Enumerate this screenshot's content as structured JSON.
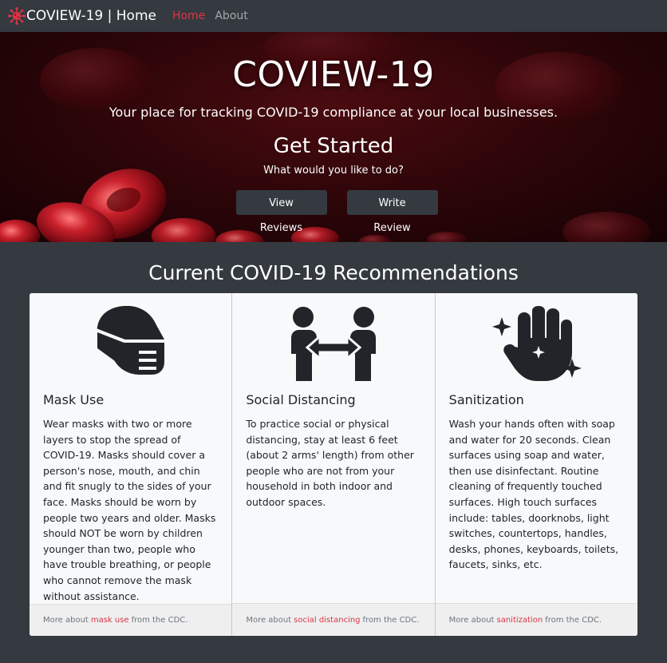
{
  "nav": {
    "brand": "COVIEW-19 | Home",
    "links": [
      "Home",
      "About"
    ]
  },
  "hero": {
    "title": "COVIEW-19",
    "lead": "Your place for tracking COVID-19 compliance at your local businesses.",
    "cta_title": "Get Started",
    "cta_prompt": "What would you like to do?",
    "buttons": [
      "View Reviews",
      "Write Review"
    ]
  },
  "recommendations": {
    "title": "Current COVID-19 Recommendations",
    "cards": [
      {
        "icon": "head-side-mask-icon",
        "title": "Mask Use",
        "text": "Wear masks with two or more layers to stop the spread of COVID-19. Masks should cover a person's nose, mouth, and chin and fit snugly to the sides of your face. Masks should be worn by people two years and older. Masks should NOT be worn by children younger than two, people who have trouble breathing, or people who cannot remove the mask without assistance.",
        "footer_prefix": "More about",
        "footer_link": "mask use",
        "footer_suffix": "from the CDC."
      },
      {
        "icon": "people-arrows-icon",
        "title": "Social Distancing",
        "text": "To practice social or physical distancing, stay at least 6 feet (about 2 arms' length) from other people who are not from your household in both indoor and outdoor spaces.",
        "footer_prefix": "More about",
        "footer_link": "social distancing",
        "footer_suffix": "from the CDC."
      },
      {
        "icon": "hand-sparkles-icon",
        "title": "Sanitization",
        "text": "Wash your hands often with soap and water for 20 seconds. Clean surfaces using soap and water, then use disinfectant. Routine cleaning of frequently touched surfaces. High touch surfaces include: tables, doorknobs, light switches, countertops, handles, desks, phones, keyboards, toilets, faucets, sinks, etc.",
        "footer_prefix": "More about",
        "footer_link": "sanitization",
        "footer_suffix": "from the CDC."
      }
    ]
  },
  "colors": {
    "navbar": "#343a40",
    "accent": "#dc3545",
    "card": "#f8f9fa"
  }
}
